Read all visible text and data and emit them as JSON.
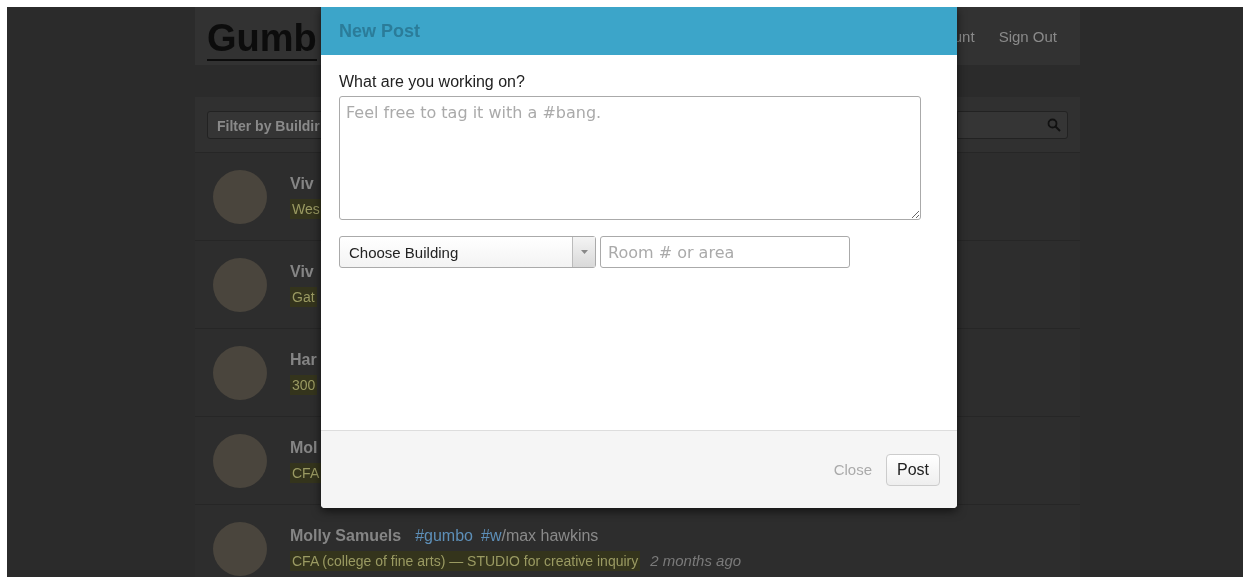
{
  "page": {
    "logo": "Gumb",
    "nav": [
      "unt",
      "Sign Out"
    ],
    "filter": {
      "value": "Filter by Buildir"
    },
    "posts": [
      {
        "kind": "partial",
        "author": "Viv",
        "location": "Wes"
      },
      {
        "kind": "partial",
        "author": "Viv",
        "location": "Gat"
      },
      {
        "kind": "partial",
        "author": "Har",
        "location": "300"
      },
      {
        "kind": "partial",
        "author": "Mol",
        "location": "CFA"
      },
      {
        "kind": "full",
        "author": "Molly Samuels",
        "tags": [
          "#gumbo",
          "#w"
        ],
        "text": "/max hawkins",
        "location": "CFA (college of fine arts) — STUDIO for creative inquiry",
        "time": "2 months ago"
      }
    ]
  },
  "modal": {
    "title": "New Post",
    "label": "What are you working on?",
    "message": {
      "placeholder": "Feel free to tag it with a #bang."
    },
    "building": {
      "value": "Choose Building"
    },
    "room": {
      "placeholder": "Room # or area"
    },
    "buttons": [
      {
        "label": "Close",
        "kind": "link"
      },
      {
        "label": "Post",
        "kind": "default"
      }
    ]
  }
}
